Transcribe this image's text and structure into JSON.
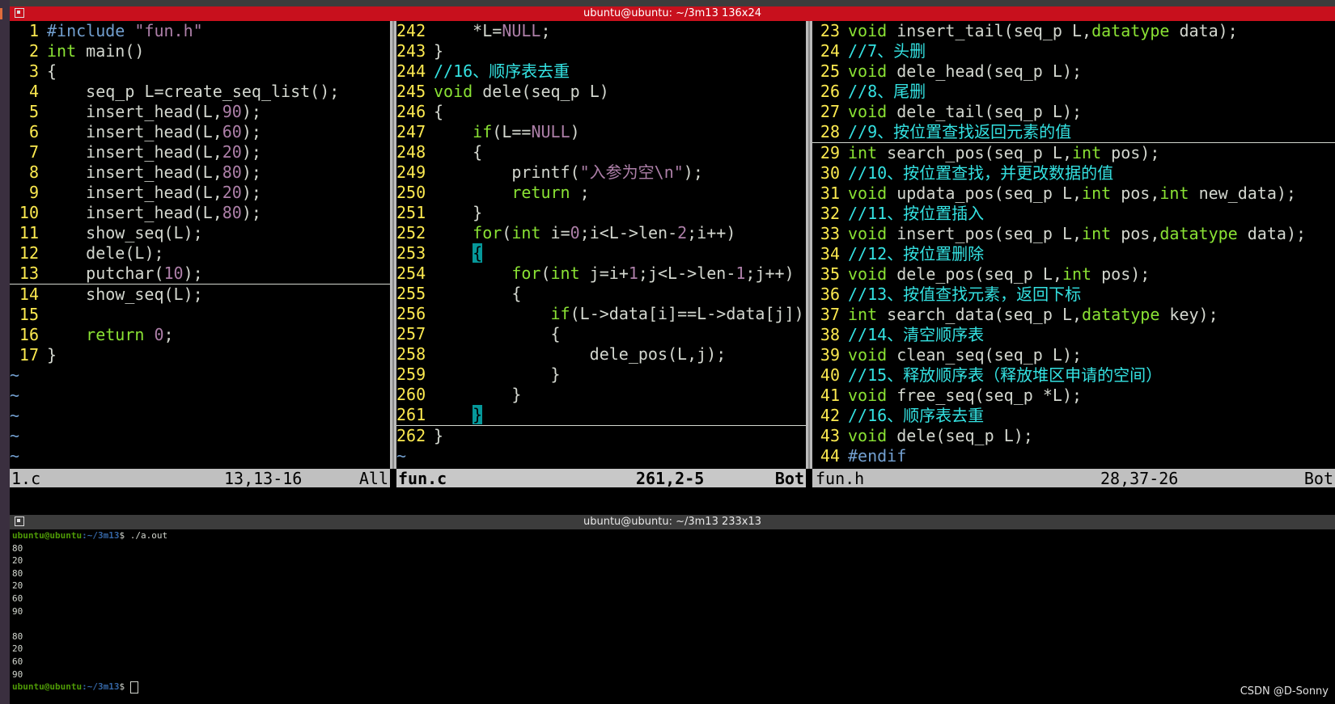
{
  "vim_window": {
    "title": "ubuntu@ubuntu: ~/3m13 136x24",
    "left_pane": {
      "filename": "1.c",
      "position": "13,13-16",
      "scroll": "All",
      "lines": [
        {
          "n": "1",
          "text": "#include \"fun.h\""
        },
        {
          "n": "2",
          "text": "int main()"
        },
        {
          "n": "3",
          "text": "{"
        },
        {
          "n": "4",
          "text": "    seq_p L=create_seq_list();"
        },
        {
          "n": "5",
          "text": "    insert_head(L,90);"
        },
        {
          "n": "6",
          "text": "    insert_head(L,60);"
        },
        {
          "n": "7",
          "text": "    insert_head(L,20);"
        },
        {
          "n": "8",
          "text": "    insert_head(L,80);"
        },
        {
          "n": "9",
          "text": "    insert_head(L,20);"
        },
        {
          "n": "10",
          "text": "    insert_head(L,80);"
        },
        {
          "n": "11",
          "text": "    show_seq(L);"
        },
        {
          "n": "12",
          "text": "    dele(L);"
        },
        {
          "n": "13",
          "text": "    putchar(10);"
        },
        {
          "n": "14",
          "text": "    show_seq(L);"
        },
        {
          "n": "15",
          "text": ""
        },
        {
          "n": "16",
          "text": "    return 0;"
        },
        {
          "n": "17",
          "text": "}"
        }
      ],
      "tilde_count": 5
    },
    "middle_pane": {
      "filename": "fun.c",
      "position": "261,2-5",
      "scroll": "Bot",
      "lines": [
        {
          "n": "242",
          "text": "    *L=NULL;"
        },
        {
          "n": "243",
          "text": "}"
        },
        {
          "n": "244",
          "text": "//16、顺序表去重"
        },
        {
          "n": "245",
          "text": "void dele(seq_p L)"
        },
        {
          "n": "246",
          "text": "{"
        },
        {
          "n": "247",
          "text": "    if(L==NULL)"
        },
        {
          "n": "248",
          "text": "    {"
        },
        {
          "n": "249",
          "text": "        printf(\"入参为空\\n\");"
        },
        {
          "n": "250",
          "text": "        return ;"
        },
        {
          "n": "251",
          "text": "    }"
        },
        {
          "n": "252",
          "text": "    for(int i=0;i<L->len-2;i++)"
        },
        {
          "n": "253",
          "text": "    {"
        },
        {
          "n": "254",
          "text": "        for(int j=i+1;j<L->len-1;j++)"
        },
        {
          "n": "255",
          "text": "        {"
        },
        {
          "n": "256",
          "text": "            if(L->data[i]==L->data[j])"
        },
        {
          "n": "257",
          "text": "            {"
        },
        {
          "n": "258",
          "text": "                dele_pos(L,j);"
        },
        {
          "n": "259",
          "text": "            }"
        },
        {
          "n": "260",
          "text": "        }"
        },
        {
          "n": "261",
          "text": "    }"
        },
        {
          "n": "262",
          "text": "}"
        }
      ],
      "tilde_count": 1
    },
    "right_pane": {
      "filename": "fun.h",
      "position": "28,37-26",
      "scroll": "Bot",
      "lines": [
        {
          "n": "23",
          "text": "void insert_tail(seq_p L,datatype data);"
        },
        {
          "n": "24",
          "text": "//7、头删"
        },
        {
          "n": "25",
          "text": "void dele_head(seq_p L);"
        },
        {
          "n": "26",
          "text": "//8、尾删"
        },
        {
          "n": "27",
          "text": "void dele_tail(seq_p L);"
        },
        {
          "n": "28",
          "text": "//9、按位置查找返回元素的值"
        },
        {
          "n": "29",
          "text": "int search_pos(seq_p L,int pos);"
        },
        {
          "n": "30",
          "text": "//10、按位置查找，并更改数据的值"
        },
        {
          "n": "31",
          "text": "void updata_pos(seq_p L,int pos,int new_data);"
        },
        {
          "n": "32",
          "text": "//11、按位置插入"
        },
        {
          "n": "33",
          "text": "void insert_pos(seq_p L,int pos,datatype data);"
        },
        {
          "n": "34",
          "text": "//12、按位置删除"
        },
        {
          "n": "35",
          "text": "void dele_pos(seq_p L,int pos);"
        },
        {
          "n": "36",
          "text": "//13、按值查找元素，返回下标"
        },
        {
          "n": "37",
          "text": "int search_data(seq_p L,datatype key);"
        },
        {
          "n": "38",
          "text": "//14、清空顺序表"
        },
        {
          "n": "39",
          "text": "void clean_seq(seq_p L);"
        },
        {
          "n": "40",
          "text": "//15、释放顺序表（释放堆区申请的空间）"
        },
        {
          "n": "41",
          "text": "void free_seq(seq_p *L);"
        },
        {
          "n": "42",
          "text": "//16、顺序表去重"
        },
        {
          "n": "43",
          "text": "void dele(seq_p L);"
        },
        {
          "n": "44",
          "text": "#endif"
        }
      ]
    }
  },
  "terminal_window": {
    "title": "ubuntu@ubuntu: ~/3m13 233x13",
    "prompt_user": "ubuntu@ubuntu",
    "prompt_path": ":~/3m13",
    "prompt_sign": "$ ",
    "command": "./a.out",
    "output": [
      "80",
      "20",
      "80",
      "20",
      "60",
      "90",
      "",
      "80",
      "20",
      "60",
      "90"
    ]
  },
  "watermark": "CSDN @D-Sonny"
}
